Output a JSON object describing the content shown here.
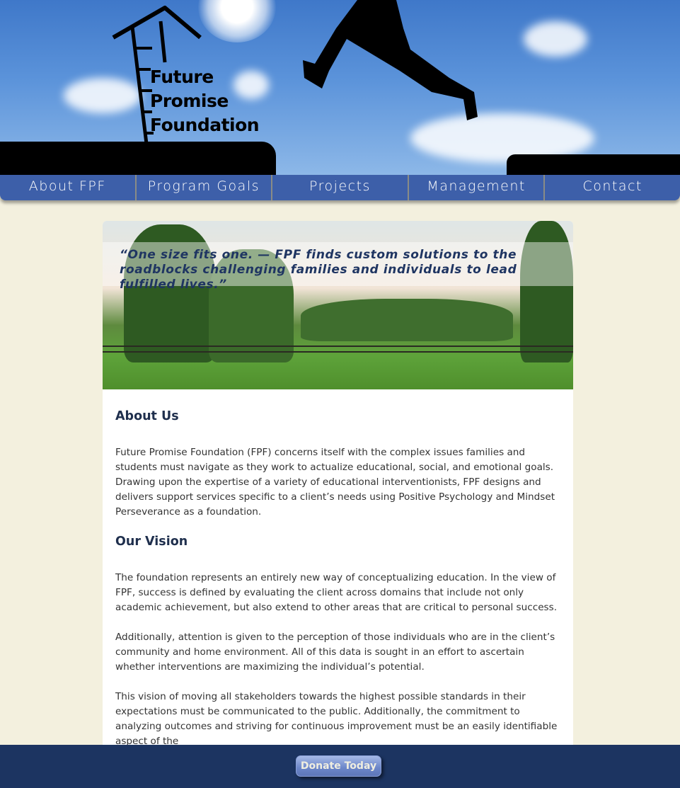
{
  "logo": {
    "line1": "Future",
    "line2": "Promise",
    "line3": "Foundation"
  },
  "nav": [
    "About FPF",
    "Program Goals",
    "Projects",
    "Management",
    "Contact"
  ],
  "banner": {
    "quote": "“One size fits one.  —  FPF finds custom solutions to the roadblocks challenging families and individuals to lead fulfilled lives.”"
  },
  "about": {
    "heading": "About Us",
    "paragraphs": [
      "Future Promise Foundation (FPF) concerns itself with the complex issues families and students must navigate as they work to actualize educational, social, and emotional goals. Drawing upon the expertise of a variety of educational interventionists, FPF designs and delivers support services specific to a client’s needs using Positive Psychology and Mindset Perseverance as a foundation."
    ]
  },
  "vision": {
    "heading": "Our Vision",
    "paragraphs": [
      "The foundation represents an entirely new way of conceptualizing education. In the view of FPF, success is defined by evaluating the client across domains that include not only academic achievement, but also extend to other areas that are critical to personal success.",
      "Additionally, attention is given to the perception of those individuals who are in the client’s community and home environment. All of this data is sought in an effort to ascertain whether interventions are maximizing the individual’s potential.",
      "This vision of moving all stakeholders towards the highest possible standards in their expectations must be communicated to the public. Additionally, the commitment to analyzing outcomes and striving for continuous improvement must be an easily identifiable aspect of the"
    ]
  },
  "footer": {
    "donate_label": "Donate Today"
  }
}
